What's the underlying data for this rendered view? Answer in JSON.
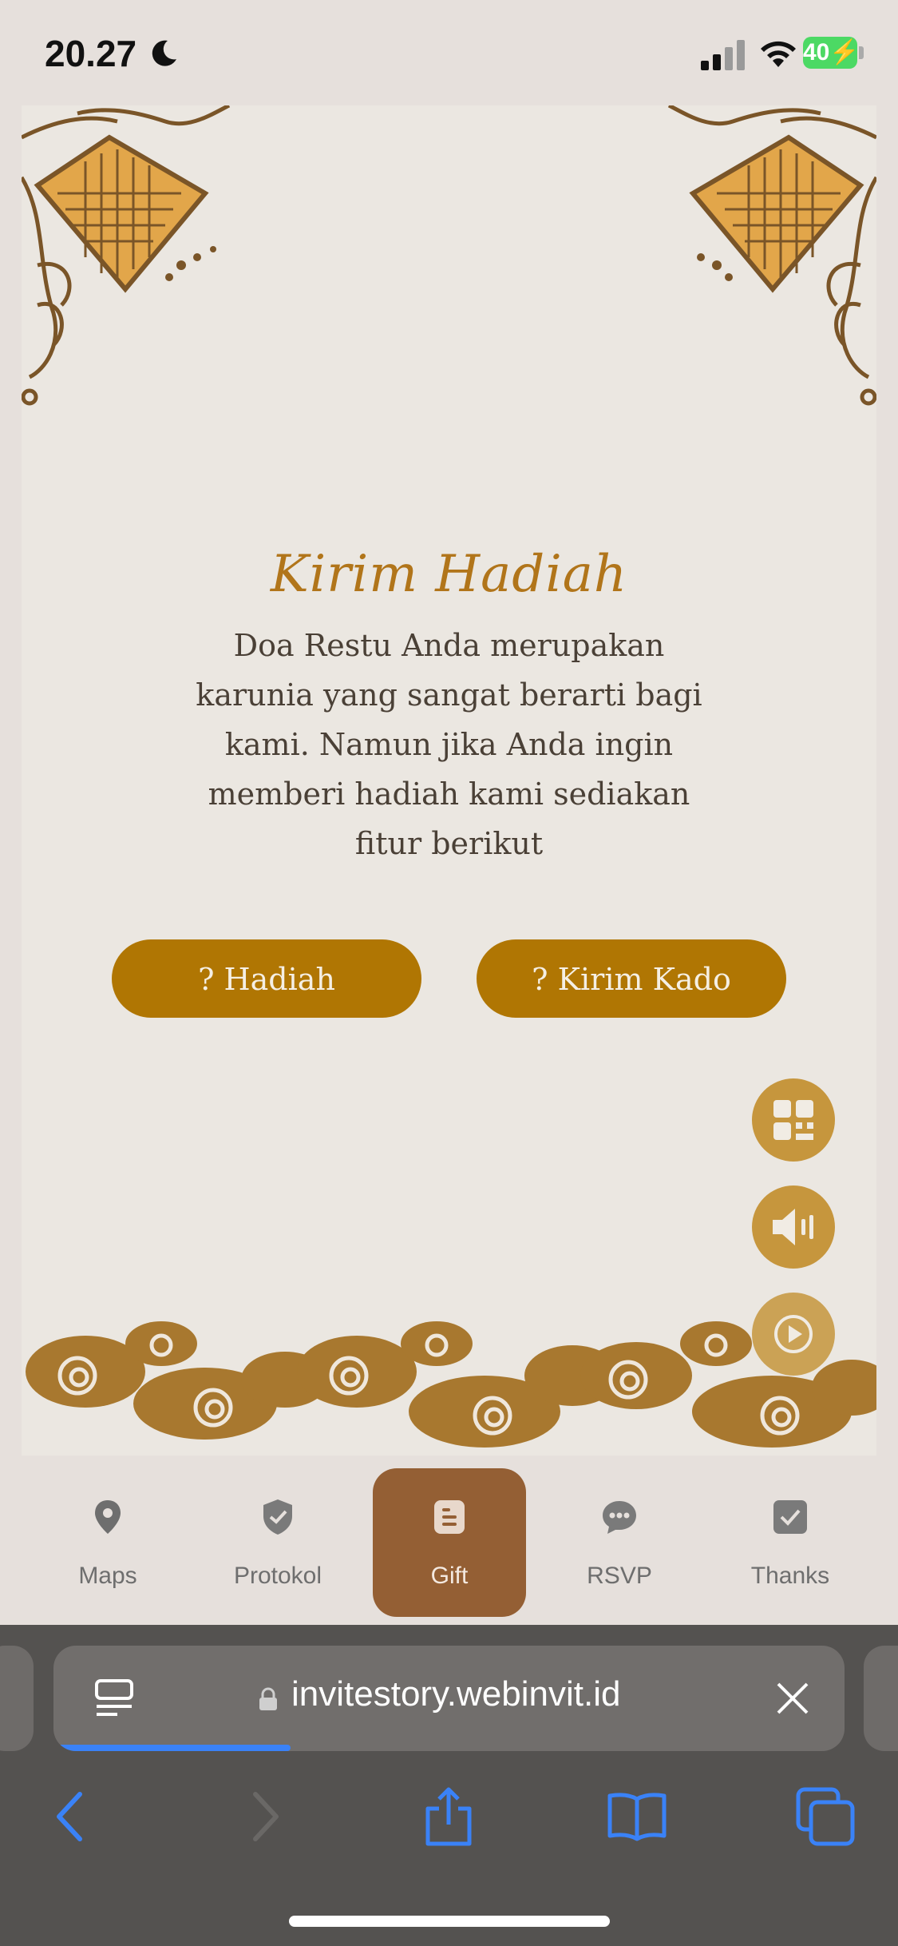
{
  "status_bar": {
    "time": "20.27",
    "battery_level": "40",
    "icons": [
      "moon-icon",
      "signal-icon",
      "wifi-icon",
      "battery-charging-icon"
    ]
  },
  "gift_section": {
    "title": "Kirim Hadiah",
    "description": "Doa Restu Anda merupakan karunia yang sangat berarti bagi kami. Namun jika Anda ingin memberi hadiah kami sediakan fitur berikut",
    "buttons": {
      "hadiah": "? Hadiah",
      "kirim_kado": "? Kirim Kado"
    },
    "accent_color": "#b07603",
    "title_color": "#b1751a"
  },
  "floating_buttons": [
    "qr-code-icon",
    "speaker-icon",
    "play-icon"
  ],
  "bottom_nav": {
    "items": [
      {
        "label": "Maps",
        "icon": "map-pin-icon",
        "active": false
      },
      {
        "label": "Protokol",
        "icon": "shield-check-icon",
        "active": false
      },
      {
        "label": "Gift",
        "icon": "document-icon",
        "active": true
      },
      {
        "label": "RSVP",
        "icon": "chat-bubble-icon",
        "active": false
      },
      {
        "label": "Thanks",
        "icon": "check-square-icon",
        "active": false
      }
    ],
    "active_color": "#945f34"
  },
  "browser": {
    "url": "invitestory.webinvit.id",
    "load_progress": 0.3,
    "toolbar_icons": [
      "back-icon",
      "forward-icon",
      "share-icon",
      "bookmarks-icon",
      "tabs-icon"
    ]
  }
}
